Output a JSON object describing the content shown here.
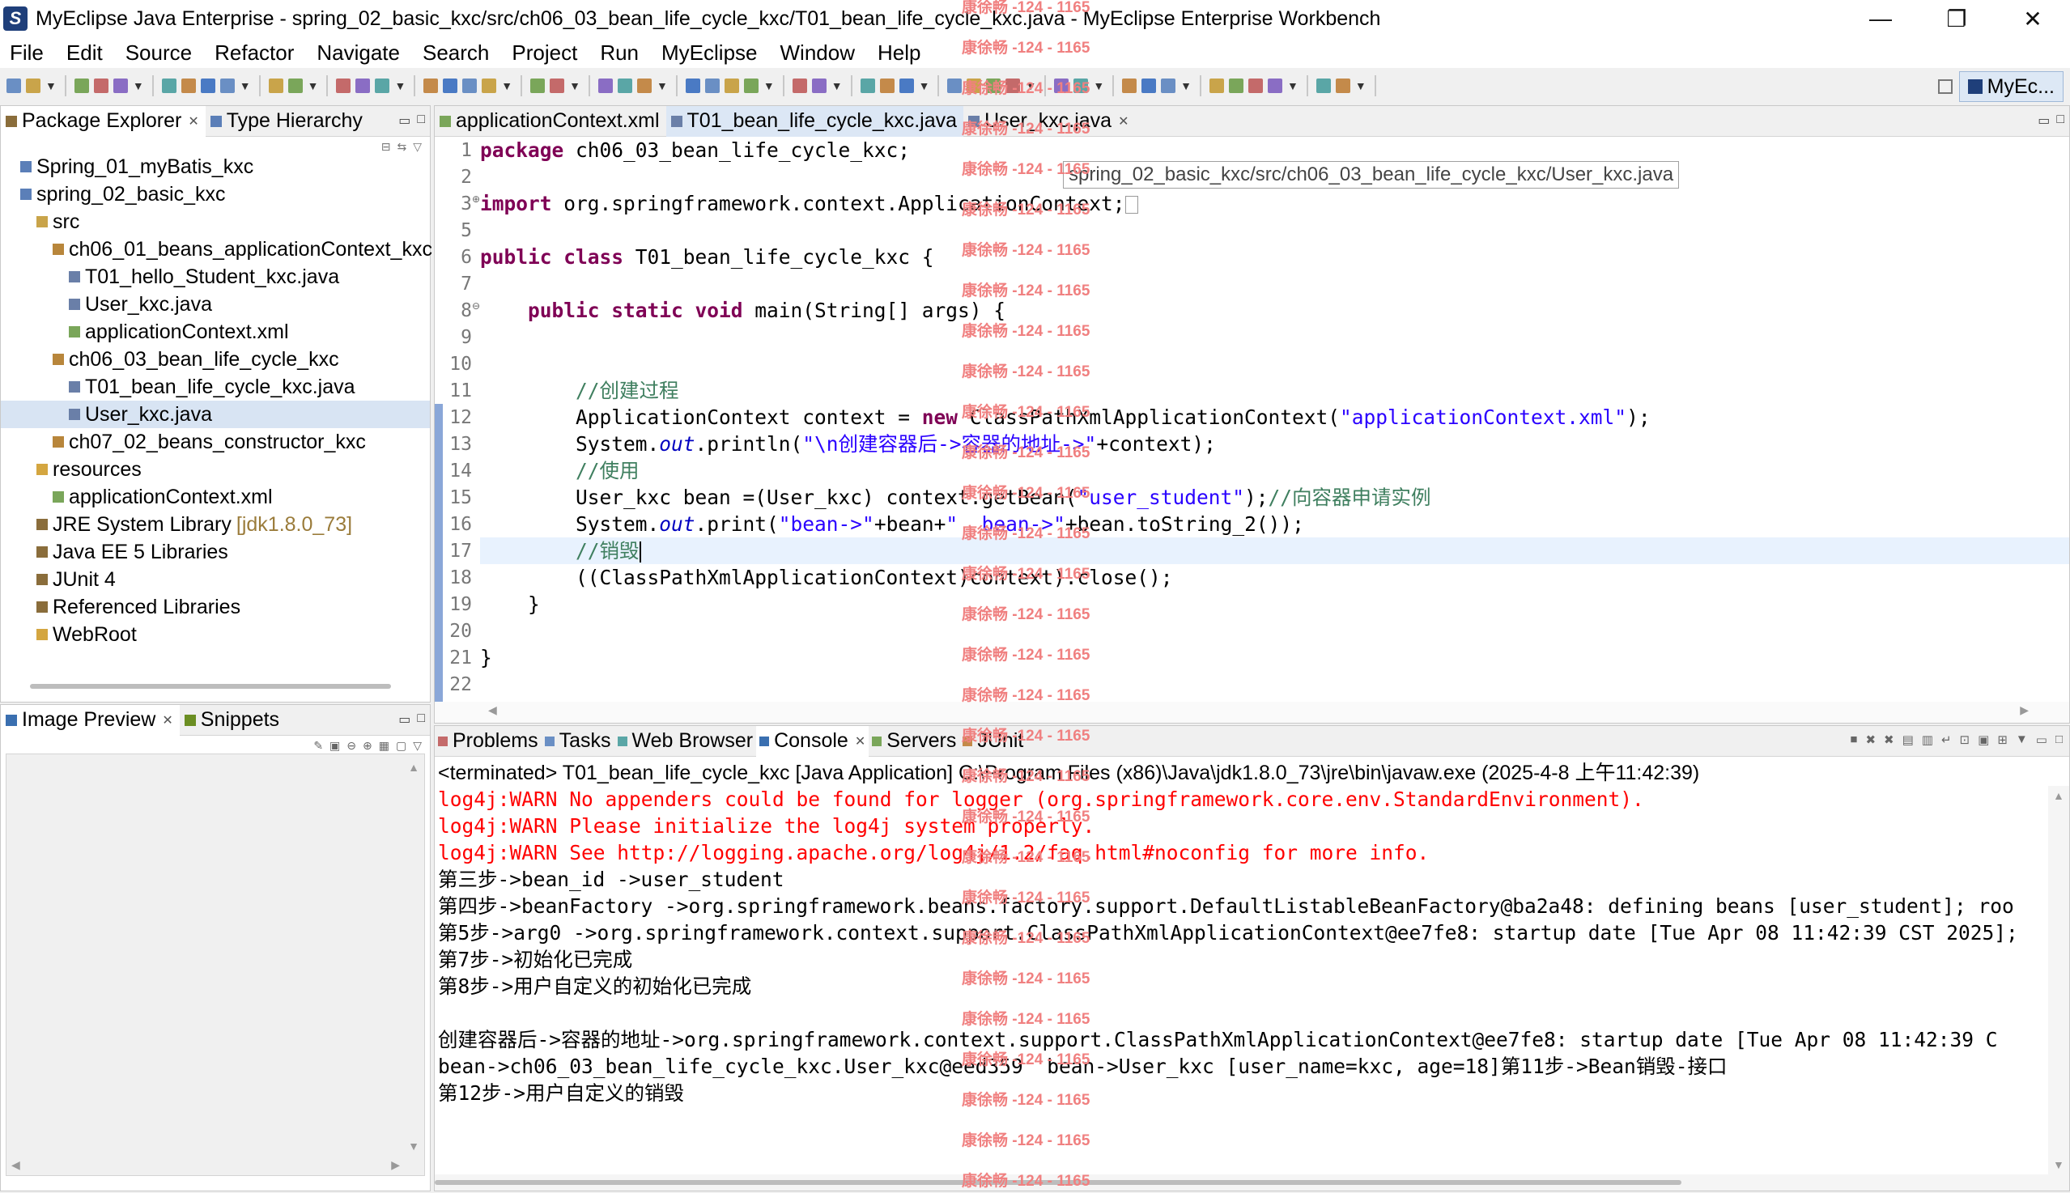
{
  "window": {
    "title": "MyEclipse Java Enterprise - spring_02_basic_kxc/src/ch06_03_bean_life_cycle_kxc/T01_bean_life_cycle_kxc.java - MyEclipse Enterprise Workbench",
    "minimize": "—",
    "maximize": "❐",
    "close": "✕"
  },
  "menu": [
    "File",
    "Edit",
    "Source",
    "Refactor",
    "Navigate",
    "Search",
    "Project",
    "Run",
    "MyEclipse",
    "Window",
    "Help"
  ],
  "perspective": {
    "label": "MyEc..."
  },
  "package_explorer": {
    "tabs": [
      "Package Explorer",
      "Type Hierarchy"
    ],
    "tree": [
      {
        "label": "Spring_01_myBatis_kxc",
        "indent": 0,
        "icon": "project-icon"
      },
      {
        "label": "spring_02_basic_kxc",
        "indent": 0,
        "icon": "project-icon"
      },
      {
        "label": "src",
        "indent": 1,
        "icon": "source-folder-icon"
      },
      {
        "label": "ch06_01_beans_applicationContext_kxc",
        "indent": 2,
        "icon": "package-icon"
      },
      {
        "label": "T01_hello_Student_kxc.java",
        "indent": 3,
        "icon": "java-file-icon"
      },
      {
        "label": "User_kxc.java",
        "indent": 3,
        "icon": "java-file-icon"
      },
      {
        "label": "applicationContext.xml",
        "indent": 3,
        "icon": "xml-file-icon"
      },
      {
        "label": "ch06_03_bean_life_cycle_kxc",
        "indent": 2,
        "icon": "package-icon"
      },
      {
        "label": "T01_bean_life_cycle_kxc.java",
        "indent": 3,
        "icon": "java-file-icon"
      },
      {
        "label": "User_kxc.java",
        "indent": 3,
        "icon": "java-file-icon",
        "selected": true
      },
      {
        "label": "ch07_02_beans_constructor_kxc",
        "indent": 2,
        "icon": "package-icon"
      },
      {
        "label": "resources",
        "indent": 1,
        "icon": "folder-icon"
      },
      {
        "label": "applicationContext.xml",
        "indent": 2,
        "icon": "xml-file-icon"
      },
      {
        "label": "JRE System Library",
        "version": "[jdk1.8.0_73]",
        "indent": 1,
        "icon": "library-icon"
      },
      {
        "label": "Java EE 5 Libraries",
        "indent": 1,
        "icon": "library-icon"
      },
      {
        "label": "JUnit 4",
        "indent": 1,
        "icon": "library-icon"
      },
      {
        "label": "Referenced Libraries",
        "indent": 1,
        "icon": "library-icon"
      },
      {
        "label": "WebRoot",
        "indent": 1,
        "icon": "folder-icon"
      }
    ]
  },
  "image_preview": {
    "tabs": [
      "Image Preview",
      "Snippets"
    ]
  },
  "editor": {
    "tabs": [
      "applicationContext.xml",
      "T01_bean_life_cycle_kxc.java",
      "User_kxc.java"
    ],
    "active_tab": 1,
    "hover_tooltip": "spring_02_basic_kxc/src/ch06_03_bean_life_cycle_kxc/User_kxc.java",
    "line_numbers": [
      "1",
      "2",
      "3",
      "5",
      "6",
      "7",
      "8",
      "9",
      "10",
      "11",
      "12",
      "13",
      "14",
      "15",
      "16",
      "17",
      "18",
      "19",
      "20",
      "21",
      "22"
    ],
    "line_3_marker": "⊕",
    "line_8_marker": "⊖"
  },
  "console": {
    "tabs": [
      "Problems",
      "Tasks",
      "Web Browser",
      "Console",
      "Servers",
      "JUnit"
    ],
    "active_tab": 3,
    "header": "<terminated> T01_bean_life_cycle_kxc [Java Application] C:\\Program Files (x86)\\Java\\jdk1.8.0_73\\jre\\bin\\javaw.exe (2025-4-8 上午11:42:39)",
    "lines": [
      {
        "text": "log4j:WARN No appenders could be found for logger (org.springframework.core.env.StandardEnvironment).",
        "red": true
      },
      {
        "text": "log4j:WARN Please initialize the log4j system properly.",
        "red": true
      },
      {
        "text": "log4j:WARN See http://logging.apache.org/log4j/1.2/faq.html#noconfig for more info.",
        "red": true
      },
      {
        "text": "第三步->bean_id ->user_student",
        "red": false
      },
      {
        "text": "第四步->beanFactory ->org.springframework.beans.factory.support.DefaultListableBeanFactory@ba2a48: defining beans [user_student]; roo",
        "red": false
      },
      {
        "text": "第5步->arg0 ->org.springframework.context.support.ClassPathXmlApplicationContext@ee7fe8: startup date [Tue Apr 08 11:42:39 CST 2025];",
        "red": false
      },
      {
        "text": "第7步->初始化已完成",
        "red": false
      },
      {
        "text": "第8步->用户自定义的初始化已完成",
        "red": false
      },
      {
        "text": "",
        "red": false
      },
      {
        "text": "创建容器后->容器的地址->org.springframework.context.support.ClassPathXmlApplicationContext@ee7fe8: startup date [Tue Apr 08 11:42:39 C",
        "red": false
      },
      {
        "text": "bean->ch06_03_bean_life_cycle_kxc.User_kxc@eed359  bean->User_kxc [user_name=kxc, age=18]第11步->Bean销毁-接口",
        "red": false
      },
      {
        "text": "第12步->用户自定义的销毁",
        "red": false
      }
    ]
  },
  "watermark": {
    "text": "康徐畅 -124 - 1165",
    "count": 30
  },
  "colors": {
    "keyword": "#7f0055",
    "string": "#2a00ff",
    "comment": "#3f7f5f",
    "static_field": "#0000c0",
    "error_text": "#ff0000",
    "watermark": "#f08080",
    "selection": "#d8e4f3"
  }
}
